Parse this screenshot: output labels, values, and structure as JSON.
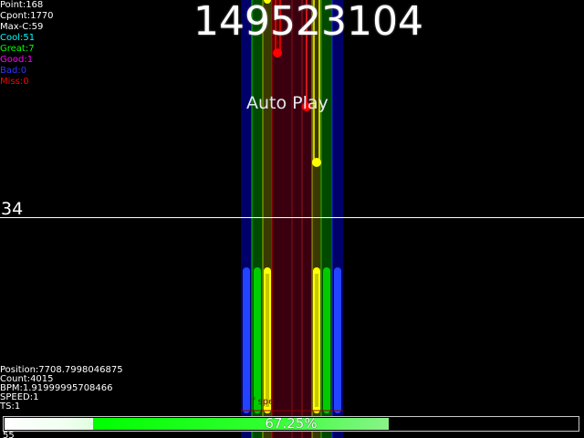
{
  "score": "149523104",
  "mode_label": "Auto Play",
  "measure_number": "34",
  "stats": [
    {
      "key": "point",
      "text": "Point:168",
      "color": "#ffffff"
    },
    {
      "key": "cpoint",
      "text": "Cpont:1770",
      "color": "#ffffff"
    },
    {
      "key": "max_combo",
      "text": "Max-C:59",
      "color": "#ffffff"
    },
    {
      "key": "cool",
      "text": "Cool:51",
      "color": "#00ffff"
    },
    {
      "key": "great",
      "text": "Great:7",
      "color": "#00ff00"
    },
    {
      "key": "good",
      "text": "Good:1",
      "color": "#ff00ff"
    },
    {
      "key": "bad",
      "text": "Bad:0",
      "color": "#3333ff"
    },
    {
      "key": "miss",
      "text": "Miss:0",
      "color": "#ff0000"
    }
  ],
  "debug": {
    "position": "Position:7708.7998046875",
    "count": "Count:4015",
    "bpm": "BPM:1.91999995708466",
    "speed": "SPEED:1",
    "ts": "TS:1"
  },
  "progress": {
    "percent_text": "67.25%",
    "fraction": 0.6725,
    "played_fraction": 0.155
  },
  "speed_label": "f spe",
  "bottom_remnant": "55",
  "colors": {
    "lane_blue": "#0000ff",
    "lane_green": "#00ff00",
    "lane_yellow": "#ffff00",
    "lane_red": "#ff0000",
    "note_blue": "#2244ff",
    "note_green": "#00dd00",
    "note_yellow": "#ffff00",
    "note_red": "#ff0000"
  }
}
